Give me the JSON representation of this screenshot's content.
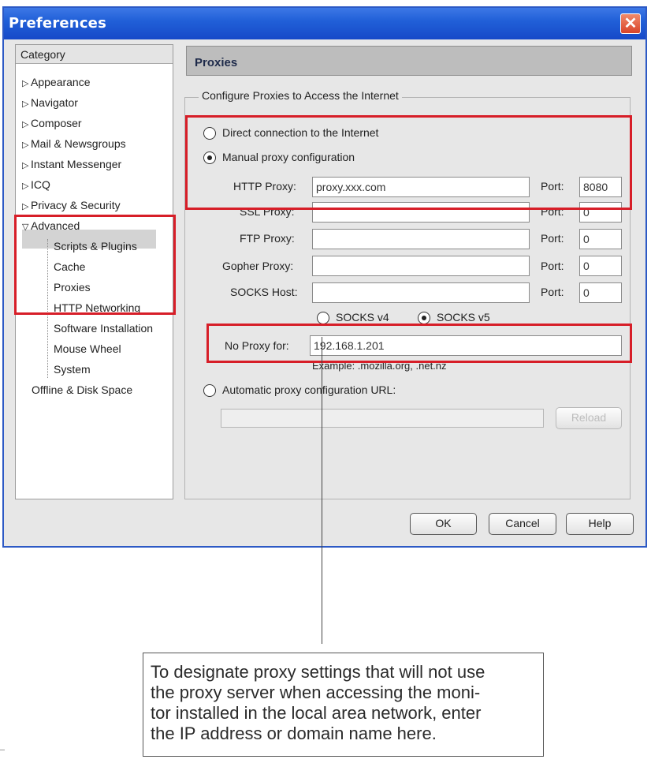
{
  "window": {
    "title": "Preferences"
  },
  "category": {
    "header": "Category",
    "items": [
      {
        "label": "Appearance"
      },
      {
        "label": "Navigator"
      },
      {
        "label": "Composer"
      },
      {
        "label": "Mail & Newsgroups"
      },
      {
        "label": "Instant Messenger"
      },
      {
        "label": "ICQ"
      },
      {
        "label": "Privacy & Security"
      },
      {
        "label": "Advanced"
      },
      {
        "label": "Scripts & Plugins"
      },
      {
        "label": "Cache"
      },
      {
        "label": "Proxies"
      },
      {
        "label": "HTTP Networking"
      },
      {
        "label": "Software Installation"
      },
      {
        "label": "Mouse Wheel"
      },
      {
        "label": "System"
      },
      {
        "label": "Offline & Disk Space"
      }
    ],
    "selected": "Proxies"
  },
  "panel": {
    "title": "Proxies",
    "group_label": "Configure Proxies to Access the Internet",
    "direct_label": "Direct connection to the Internet",
    "manual_label": "Manual proxy configuration",
    "auto_label": "Automatic proxy configuration URL:",
    "selected_mode": "manual",
    "port_label": "Port:",
    "proxies": [
      {
        "label": "HTTP Proxy:",
        "value": "proxy.xxx.com",
        "port": "8080"
      },
      {
        "label": "SSL Proxy:",
        "value": "",
        "port": "0"
      },
      {
        "label": "FTP Proxy:",
        "value": "",
        "port": "0"
      },
      {
        "label": "Gopher Proxy:",
        "value": "",
        "port": "0"
      },
      {
        "label": "SOCKS Host:",
        "value": "",
        "port": "0"
      }
    ],
    "socks_v4": "SOCKS v4",
    "socks_v5": "SOCKS v5",
    "socks_selected": "v5",
    "no_proxy_label": "No Proxy for:",
    "no_proxy_value": "192.168.1.201",
    "example": "Example: .mozilla.org, .net.nz",
    "auto_url_value": "",
    "reload_label": "Reload"
  },
  "buttons": {
    "ok": "OK",
    "cancel": "Cancel",
    "help": "Help"
  },
  "callout": {
    "lines": [
      "To designate proxy settings that will not use",
      "the proxy server when accessing the moni-",
      "tor installed in the local area network, enter",
      "the IP address or domain name here."
    ]
  },
  "colors": {
    "highlight": "#d71e28",
    "titlebar": "#2160d8"
  }
}
